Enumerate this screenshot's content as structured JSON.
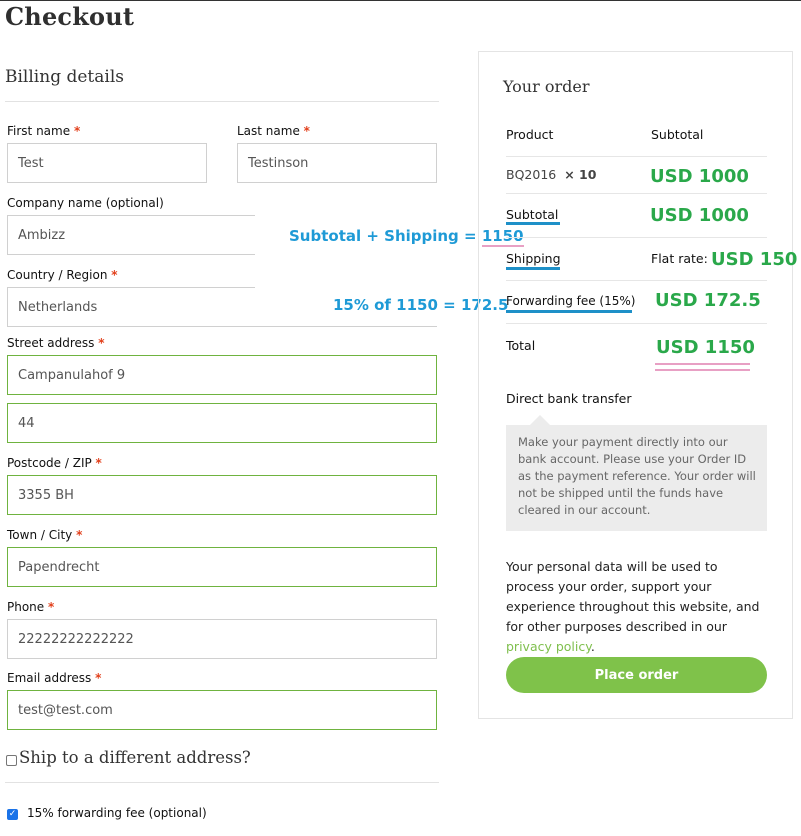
{
  "page": {
    "title": "Checkout"
  },
  "billing": {
    "heading": "Billing details",
    "first_name": {
      "label": "First name",
      "value": "Test"
    },
    "last_name": {
      "label": "Last name",
      "value": "Testinson"
    },
    "company": {
      "label": "Company name (optional)",
      "value": "Ambizz"
    },
    "country": {
      "label": "Country / Region",
      "value": "Netherlands"
    },
    "street": {
      "label": "Street address",
      "value1": "Campanulahof 9",
      "value2": "44"
    },
    "postcode": {
      "label": "Postcode / ZIP",
      "value": "3355 BH"
    },
    "city": {
      "label": "Town / City",
      "value": "Papendrecht"
    },
    "phone": {
      "label": "Phone",
      "value": "22222222222222"
    },
    "email": {
      "label": "Email address",
      "value": "test@test.com"
    },
    "required_mark": "*"
  },
  "ship_different": {
    "label": "Ship to a different address?"
  },
  "forwarding_option": {
    "label": "15% forwarding fee (optional)",
    "checked": true
  },
  "annotations": {
    "subtotal_shipping_prefix": "Subtotal + Shipping = ",
    "subtotal_shipping_value": "1150",
    "fee_calc": "15% of 1150 = 172.5"
  },
  "order": {
    "heading": "Your order",
    "col_product": "Product",
    "col_subtotal": "Subtotal",
    "item_name": "BQ2016",
    "item_qty": "× 10",
    "item_total": "USD 1000",
    "subtotal_label": "Subtotal",
    "subtotal_value": "USD 1000",
    "shipping_label": "Shipping",
    "shipping_method": "Flat rate:",
    "shipping_value": "USD 150",
    "fee_label": "Forwarding fee (15%)",
    "fee_value": "USD 172.5",
    "total_label": "Total",
    "total_value": "USD 1150",
    "payment_method": "Direct bank transfer",
    "payment_desc": "Make your payment directly into our bank account. Please use your Order ID as the payment reference. Your order will not be shipped until the funds have cleared in our account.",
    "privacy_text": "Your personal data will be used to process your order, support your experience throughout this website, and for other purposes described in our ",
    "privacy_link": "privacy policy",
    "privacy_end": ".",
    "place_order": "Place order"
  },
  "colors": {
    "accent_green": "#7fc24a",
    "annotation_blue": "#1e9ad6",
    "amount_green": "#2aa84a",
    "required_red": "#e2401c"
  }
}
